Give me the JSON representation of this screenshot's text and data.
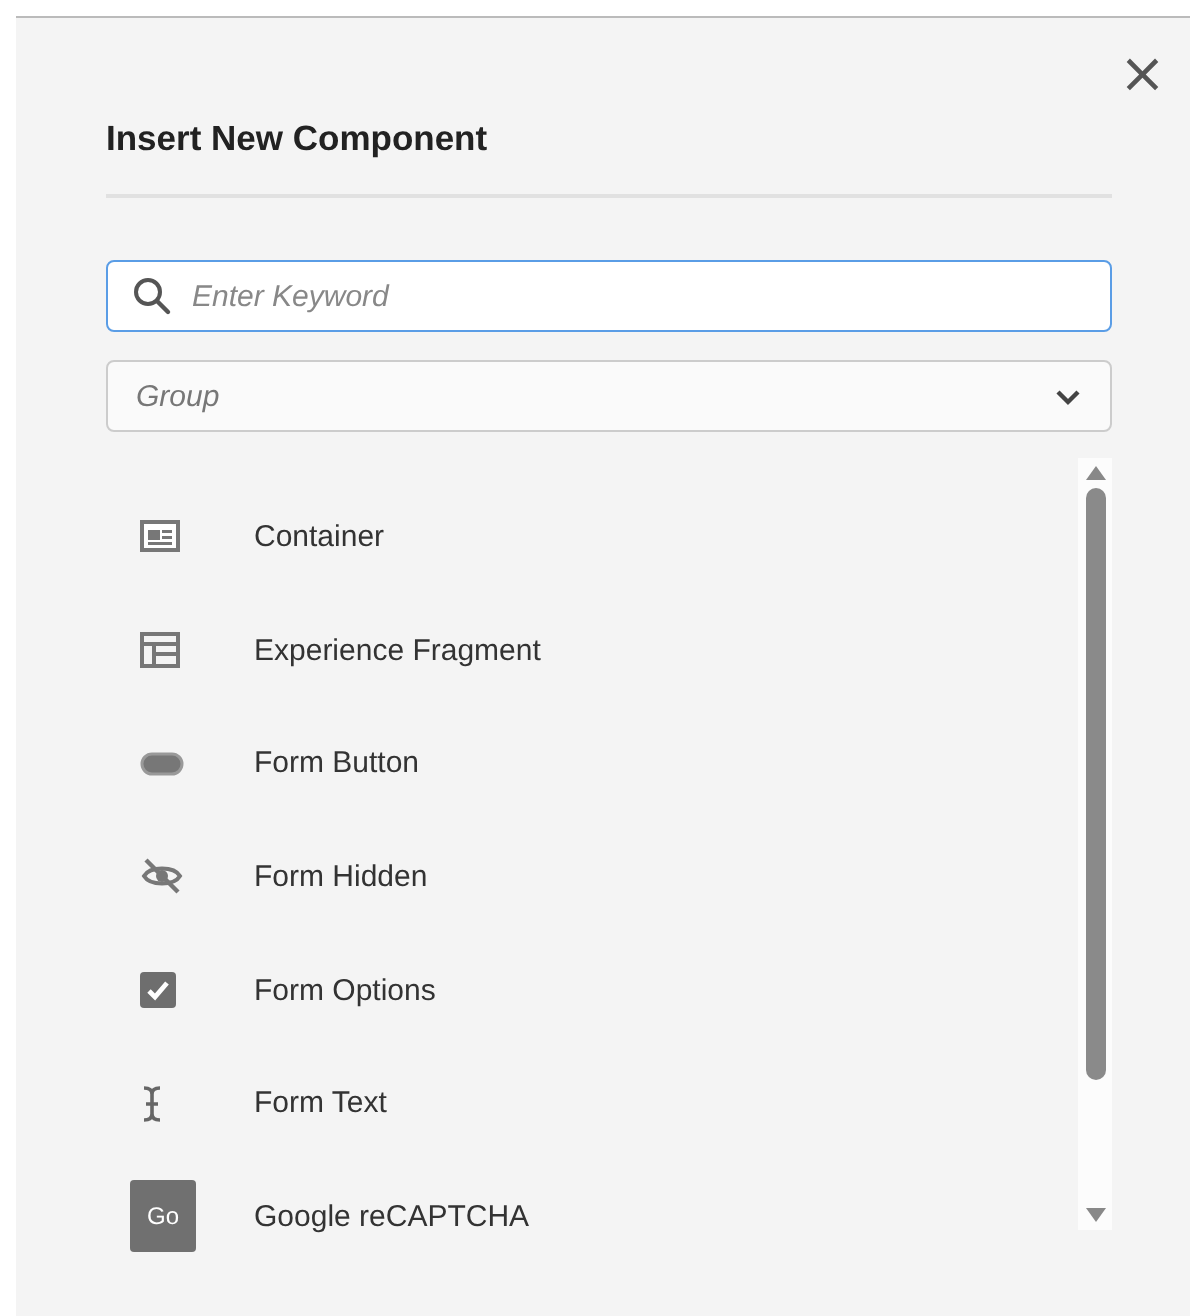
{
  "dialog": {
    "title": "Insert New Component",
    "close": "×"
  },
  "search": {
    "placeholder": "Enter Keyword"
  },
  "group_select": {
    "placeholder": "Group"
  },
  "components": [
    {
      "label": "Container",
      "kind": "container"
    },
    {
      "label": "Experience Fragment",
      "kind": "fragment"
    },
    {
      "label": "Form Button",
      "kind": "button"
    },
    {
      "label": "Form Hidden",
      "kind": "hidden"
    },
    {
      "label": "Form Options",
      "kind": "options"
    },
    {
      "label": "Form Text",
      "kind": "text"
    },
    {
      "label": "Google reCAPTCHA",
      "kind": "badge",
      "badge": "Go"
    }
  ]
}
